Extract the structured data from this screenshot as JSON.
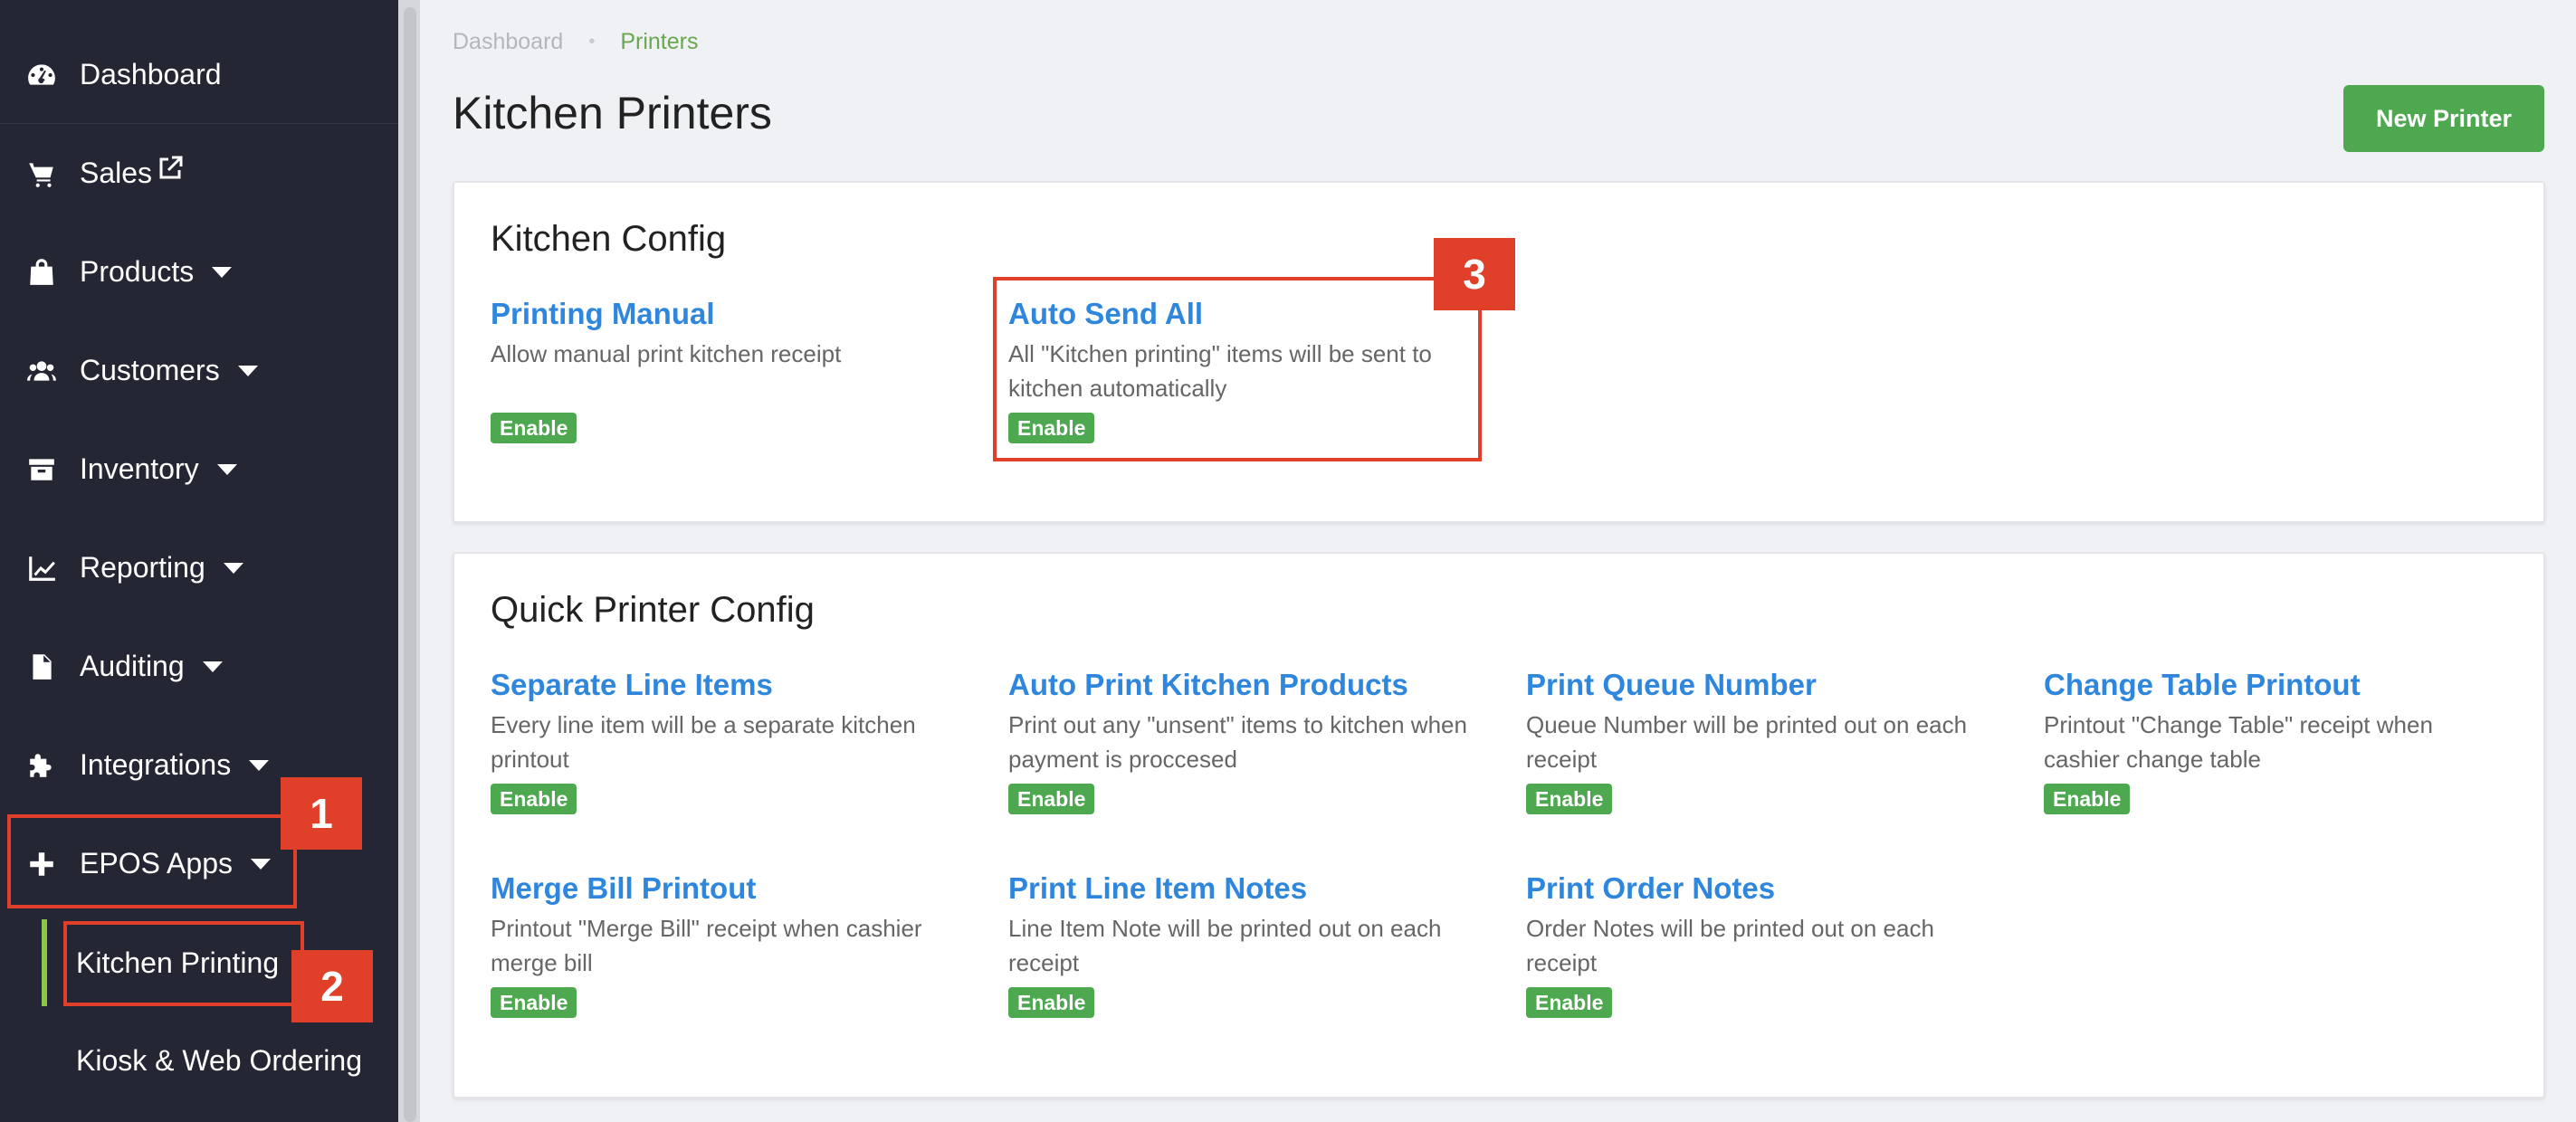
{
  "sidebar": {
    "items": [
      {
        "label": "Dashboard",
        "icon": "dashboard-icon"
      },
      {
        "label": "Sales",
        "icon": "cart-icon"
      },
      {
        "label": "Products",
        "icon": "bag-icon"
      },
      {
        "label": "Customers",
        "icon": "users-icon"
      },
      {
        "label": "Inventory",
        "icon": "archive-icon"
      },
      {
        "label": "Reporting",
        "icon": "chart-line-icon"
      },
      {
        "label": "Auditing",
        "icon": "file-icon"
      },
      {
        "label": "Integrations",
        "icon": "puzzle-icon"
      },
      {
        "label": "EPOS Apps",
        "icon": "plus-icon"
      }
    ],
    "sub_items": [
      {
        "label": "Kitchen Printing",
        "active": true
      },
      {
        "label": "Kiosk & Web Ordering",
        "active": false
      }
    ]
  },
  "breadcrumb": {
    "home": "Dashboard",
    "separator": "•",
    "current": "Printers"
  },
  "page": {
    "title": "Kitchen Printers",
    "new_button": "New Printer"
  },
  "kitchen_config": {
    "title": "Kitchen Config",
    "options": [
      {
        "title": "Printing Manual",
        "desc": "Allow manual print kitchen receipt",
        "status": "Enable"
      },
      {
        "title": "Auto Send All",
        "desc": "All \"Kitchen printing\" items will be sent to kitchen automatically",
        "status": "Enable"
      }
    ]
  },
  "quick_config": {
    "title": "Quick Printer Config",
    "options": [
      {
        "title": "Separate Line Items",
        "desc": "Every line item will be a separate kitchen printout",
        "status": "Enable"
      },
      {
        "title": "Auto Print Kitchen Products",
        "desc": "Print out any \"unsent\" items to kitchen when payment is proccesed",
        "status": "Enable"
      },
      {
        "title": "Print Queue Number",
        "desc": "Queue Number will be printed out on each receipt",
        "status": "Enable"
      },
      {
        "title": "Change Table Printout",
        "desc": "Printout \"Change Table\" receipt when cashier change table",
        "status": "Enable"
      },
      {
        "title": "Merge Bill Printout",
        "desc": "Printout \"Merge Bill\" receipt when cashier merge bill",
        "status": "Enable"
      },
      {
        "title": "Print Line Item Notes",
        "desc": "Line Item Note will be printed out on each receipt",
        "status": "Enable"
      },
      {
        "title": "Print Order Notes",
        "desc": "Order Notes will be printed out on each receipt",
        "status": "Enable"
      }
    ]
  },
  "annotations": {
    "one": "1",
    "two": "2",
    "three": "3"
  },
  "colors": {
    "sidebar": "#242634",
    "accent_green": "#4ea84f",
    "link_blue": "#2f86dd",
    "annotation_red": "#e0402a"
  }
}
